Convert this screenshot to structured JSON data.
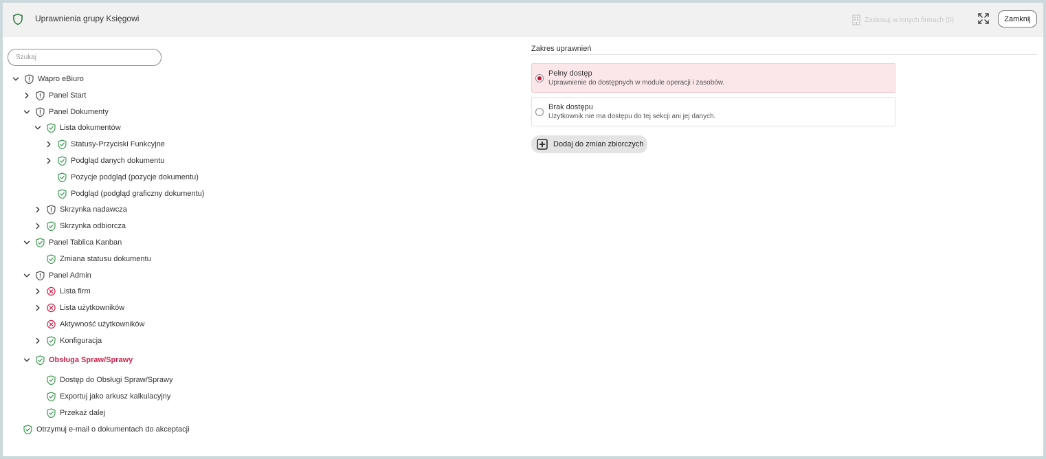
{
  "header": {
    "title": "Uprawnienia grupy Księgowi",
    "apply_label": "Zastosuj w innych firmach (0)",
    "close_label": "Zamknij"
  },
  "search": {
    "placeholder": "Szukaj"
  },
  "colors": {
    "green": "#3f9b54",
    "gray": "#5a5a5a",
    "red": "#d0234b",
    "selected_bg": "#fbe7ea"
  },
  "tree": [
    {
      "label": "Wapro eBiuro",
      "level": 0,
      "chevron": "down",
      "icon": "shield-gray"
    },
    {
      "label": "Panel Start",
      "level": 1,
      "chevron": "right",
      "icon": "shield-gray"
    },
    {
      "label": "Panel Dokumenty",
      "level": 1,
      "chevron": "down",
      "icon": "shield-gray"
    },
    {
      "label": "Lista dokumentów",
      "level": 2,
      "chevron": "down",
      "icon": "shield-green"
    },
    {
      "label": "Statusy-Przyciski Funkcyjne",
      "level": 3,
      "chevron": "right",
      "icon": "shield-green"
    },
    {
      "label": "Podgląd danych dokumentu",
      "level": 3,
      "chevron": "right",
      "icon": "shield-green"
    },
    {
      "label": "Pozycje podgląd (pozycje dokumentu)",
      "level": 3,
      "chevron": "none",
      "icon": "shield-green"
    },
    {
      "label": "Podgląd (podgląd graficzny dokumentu)",
      "level": 3,
      "chevron": "none",
      "icon": "shield-green"
    },
    {
      "label": "Skrzynka nadawcza",
      "level": 2,
      "chevron": "right",
      "icon": "shield-gray"
    },
    {
      "label": "Skrzynka odbiorcza",
      "level": 2,
      "chevron": "right",
      "icon": "shield-green"
    },
    {
      "label": "Panel Tablica Kanban",
      "level": 1,
      "chevron": "down",
      "icon": "shield-green"
    },
    {
      "label": "Zmiana statusu dokumentu",
      "level": 2,
      "chevron": "none",
      "icon": "shield-green"
    },
    {
      "label": "Panel Admin",
      "level": 1,
      "chevron": "down",
      "icon": "shield-gray"
    },
    {
      "label": "Lista firm",
      "level": 2,
      "chevron": "right",
      "icon": "x-red"
    },
    {
      "label": "Lista użytkowników",
      "level": 2,
      "chevron": "right",
      "icon": "x-red"
    },
    {
      "label": "Aktywność użytkowników",
      "level": 2,
      "chevron": "none",
      "icon": "x-red"
    },
    {
      "label": "Konfiguracja",
      "level": 2,
      "chevron": "right",
      "icon": "shield-green"
    },
    {
      "label": "Obsługa Spraw/Sprawy",
      "level": 1,
      "chevron": "down",
      "icon": "shield-green",
      "active": true
    },
    {
      "label": "Dostęp do Obsługi Spraw/Sprawy",
      "level": 2,
      "chevron": "none",
      "icon": "shield-green"
    },
    {
      "label": "Exportuj jako arkusz kalkulacyjny",
      "level": 2,
      "chevron": "none",
      "icon": "shield-green"
    },
    {
      "label": "Przekaż dalej",
      "level": 2,
      "chevron": "none",
      "icon": "shield-green"
    },
    {
      "label": "Otrzymuj e-mail o dokumentach do akceptacji",
      "level": 0,
      "chevron": "none-root",
      "icon": "shield-green"
    }
  ],
  "scope": {
    "title": "Zakres uprawnień",
    "options": [
      {
        "title": "Pełny dostęp",
        "desc": "Uprawnienie do dostępnych w module operacji i zasobów.",
        "selected": true
      },
      {
        "title": "Brak dostępu",
        "desc": "Użytkownik nie ma dostępu do tej sekcji ani jej danych.",
        "selected": false
      }
    ],
    "bulk_label": "Dodaj do zmian zbiorczych"
  }
}
